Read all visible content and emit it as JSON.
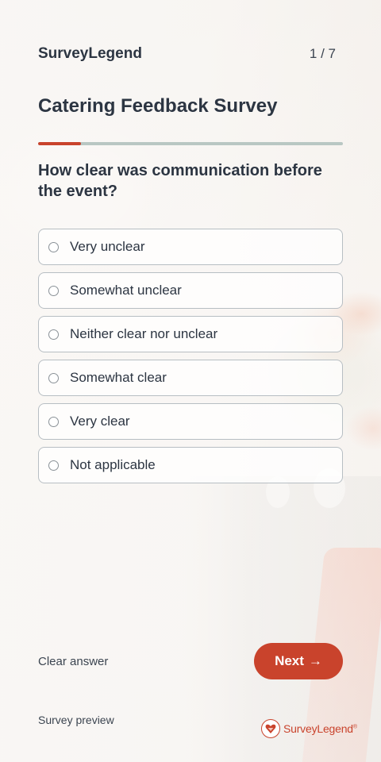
{
  "header": {
    "brand": "SurveyLegend",
    "counter": "1 / 7",
    "title": "Catering Feedback Survey"
  },
  "progress": {
    "fraction": 0.14
  },
  "question": {
    "text": "How clear was communication before the event?",
    "options": [
      {
        "label": "Very unclear",
        "selected": false
      },
      {
        "label": "Somewhat unclear",
        "selected": false
      },
      {
        "label": "Neither clear nor unclear",
        "selected": false
      },
      {
        "label": "Somewhat clear",
        "selected": false
      },
      {
        "label": "Very clear",
        "selected": false
      },
      {
        "label": "Not applicable",
        "selected": false
      }
    ]
  },
  "footer": {
    "clear_label": "Clear answer",
    "next_label": "Next",
    "next_arrow": "→",
    "preview_label": "Survey preview",
    "logo_text": "SurveyLegend",
    "logo_icon": "heart-shield-icon"
  },
  "colors": {
    "accent": "#c9432c",
    "text": "#2c3542",
    "progress_track": "#b9c7c3"
  }
}
